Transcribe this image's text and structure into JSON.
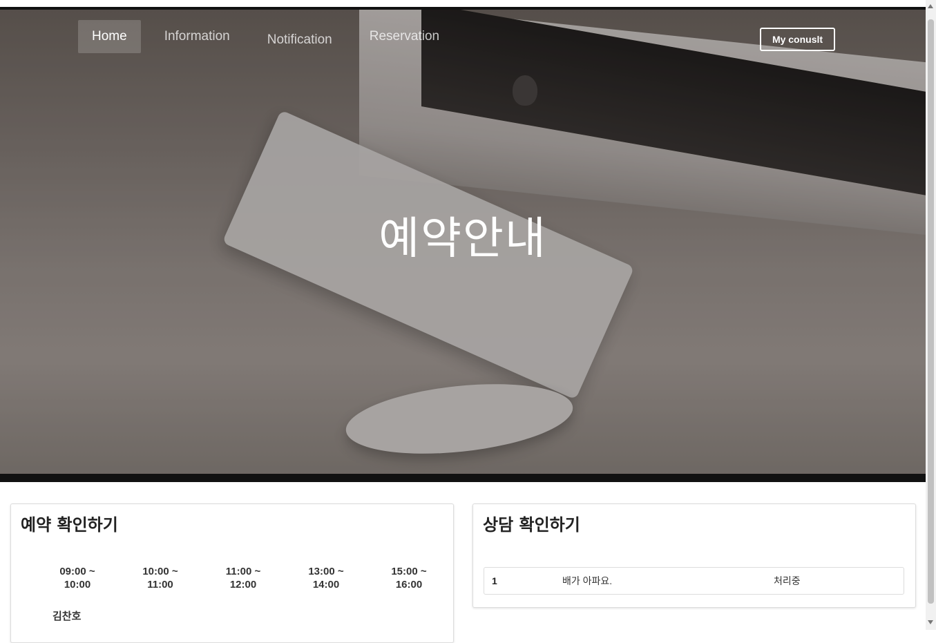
{
  "nav": {
    "items": [
      {
        "label": "Home",
        "active": true
      },
      {
        "label": "Information",
        "active": false
      },
      {
        "label": "Notification",
        "active": false
      },
      {
        "label": "Reservation",
        "active": false
      }
    ],
    "consult_button": "My conuslt"
  },
  "hero": {
    "title": "예약안내"
  },
  "reservation": {
    "title": "예약 확인하기",
    "slots": [
      {
        "start": "09:00 ~",
        "end": "10:00"
      },
      {
        "start": "10:00 ~",
        "end": "11:00"
      },
      {
        "start": "11:00 ~",
        "end": "12:00"
      },
      {
        "start": "13:00 ~",
        "end": "14:00"
      },
      {
        "start": "15:00 ~",
        "end": "16:00"
      }
    ],
    "counselor": "김찬호"
  },
  "consultation": {
    "title": "상담 확인하기",
    "rows": [
      {
        "no": "1",
        "title": "배가 아파요.",
        "status": "처리중"
      }
    ]
  }
}
